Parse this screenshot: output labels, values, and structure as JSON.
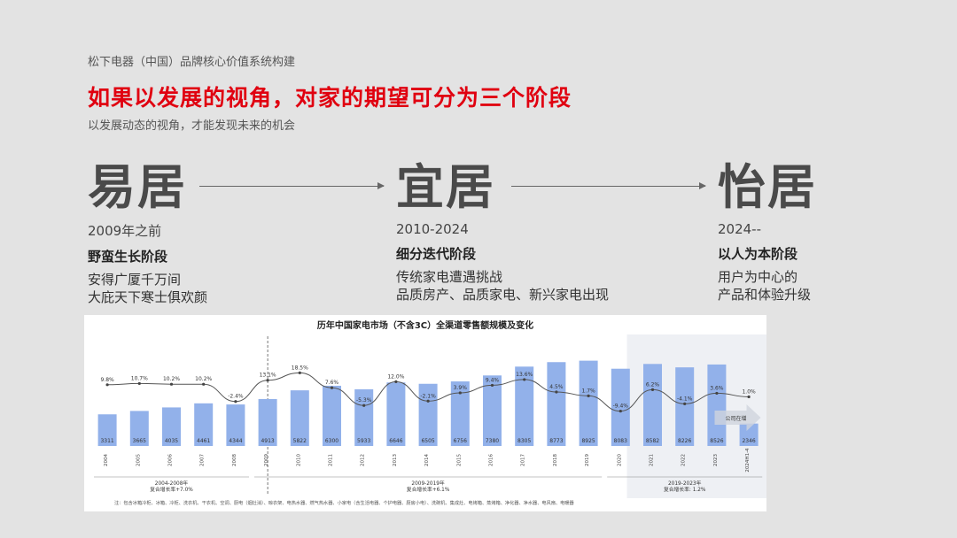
{
  "brand": "松下电器（中国）品牌核心价值系统构建",
  "headline": "如果以发展的视角，对家的期望可分为三个阶段",
  "subhead": "以发展动态的视角，才能发现未来的机会",
  "stages": [
    {
      "name": "易居",
      "period": "2009年之前",
      "phase": "野蛮生长阶段",
      "desc": [
        "安得广厦千万间",
        "大庇天下寒士俱欢颜"
      ]
    },
    {
      "name": "宜居",
      "period": "2010-2024",
      "phase": "细分迭代阶段",
      "desc": [
        "传统家电遭遇挑战",
        "品质房产、品质家电、新兴家电出现"
      ]
    },
    {
      "name": "怡居",
      "period": "2024--",
      "phase": "以人为本阶段",
      "desc": [
        "用户为中心的",
        "产品和体验升级"
      ]
    }
  ],
  "chart_data": {
    "type": "bar",
    "title": "历年中国家电市场（不含3C）全渠道零售额规模及变化",
    "categories": [
      "2004",
      "2005",
      "2006",
      "2007",
      "2008",
      "2009",
      "2010",
      "2011",
      "2012",
      "2013",
      "2014",
      "2015",
      "2016",
      "2017",
      "2018",
      "2019",
      "2020",
      "2021",
      "2022",
      "2023",
      "2024H1-4"
    ],
    "values": [
      3311,
      3665,
      4035,
      4461,
      4344,
      4913,
      5822,
      6300,
      5933,
      6646,
      6505,
      6756,
      7380,
      8305,
      8773,
      8925,
      8083,
      8582,
      8226,
      8526,
      2346
    ],
    "growth_labels": [
      "9.8%",
      "10.7%",
      "10.2%",
      "10.2%",
      "-2.4%",
      "13.1%",
      "18.5%",
      "7.6%",
      "-5.3%",
      "12.0%",
      "-2.1%",
      "3.9%",
      "9.4%",
      "13.6%",
      "4.5%",
      "1.7%",
      "-9.4%",
      "6.2%",
      "-4.1%",
      "3.6%",
      "1.0%"
    ],
    "growth_values": [
      9.8,
      10.7,
      10.2,
      10.2,
      -2.4,
      13.1,
      18.5,
      7.6,
      -5.3,
      12.0,
      -2.1,
      3.9,
      9.4,
      13.6,
      4.5,
      1.7,
      -9.4,
      6.2,
      -4.1,
      3.6,
      1.0
    ],
    "bar_color": "#92b1ea",
    "line_color": "#555555",
    "periods": [
      {
        "label": "2004-2008年",
        "cagr": "复合增长率+7.0%"
      },
      {
        "label": "2009-2019年",
        "cagr": "复合增长率+6.1%"
      },
      {
        "label": "2019-2023年",
        "cagr": "复合增长率: 1.2%"
      }
    ],
    "forecast_label": "公司在增",
    "footnote": "注：包含冰箱冷柜、冰箱、冷柜、洗衣机、干衣机、空调、厨电（烟灶消）、晾衣架、电热水器、燃气热水器、小家电（含生活电器、个护电器、厨房小电）、洗碗机、集成灶、电烤箱、蒸烤箱、净化器、净水器、电风扇、电暖器"
  }
}
